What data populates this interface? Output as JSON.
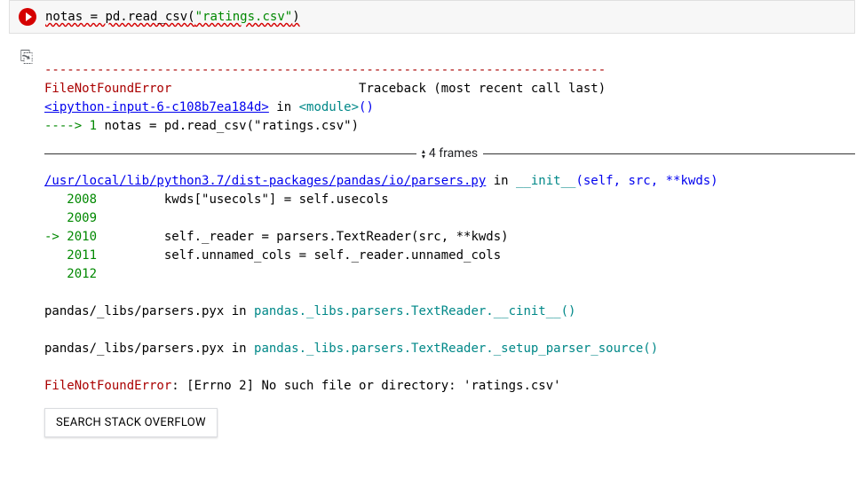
{
  "input": {
    "var": "notas",
    "eq": " = ",
    "call": "pd.read_csv(",
    "str": "\"ratings.csv\"",
    "close": ")"
  },
  "output": {
    "dashline": "---------------------------------------------------------------------------",
    "err_name": "FileNotFoundError",
    "traceback_pad": "                         ",
    "traceback_text": "Traceback (most recent call last)",
    "ipy_link": "<ipython-input-6-c108b7ea184d>",
    "in_word": " in ",
    "module_word": "<module>",
    "paren": "()",
    "arrow_line_prefix": "----> ",
    "arrow_line_num": "1",
    "arrow_line_code": " notas = pd.read_csv(\"ratings.csv\")",
    "frames_label": "4 frames",
    "parsers_link": "/usr/local/lib/python3.7/dist-packages/pandas/io/parsers.py",
    "init_word": "__init__",
    "init_args": "(self, src, **kwds)",
    "line_2008_num": "   2008",
    "line_2008_code": "         kwds[\"usecols\"] = self.usecols",
    "line_2009_num": "   2009",
    "line_2010_arrow": "-> ",
    "line_2010_num": "2010",
    "line_2010_code": "         self._reader = parsers.TextReader(src, **kwds)",
    "line_2011_num": "   2011",
    "line_2011_code": "         self.unnamed_cols = self._reader.unnamed_cols",
    "line_2012_num": "   2012",
    "pyx1_pre": "pandas/_libs/parsers.pyx in ",
    "pyx1_func": "pandas._libs.parsers.TextReader.__cinit__()",
    "pyx2_pre": "pandas/_libs/parsers.pyx in ",
    "pyx2_func": "pandas._libs.parsers.TextReader._setup_parser_source()",
    "final_err": "FileNotFoundError",
    "final_msg": ": [Errno 2] No such file or directory: 'ratings.csv'",
    "search_button": "SEARCH STACK OVERFLOW"
  }
}
